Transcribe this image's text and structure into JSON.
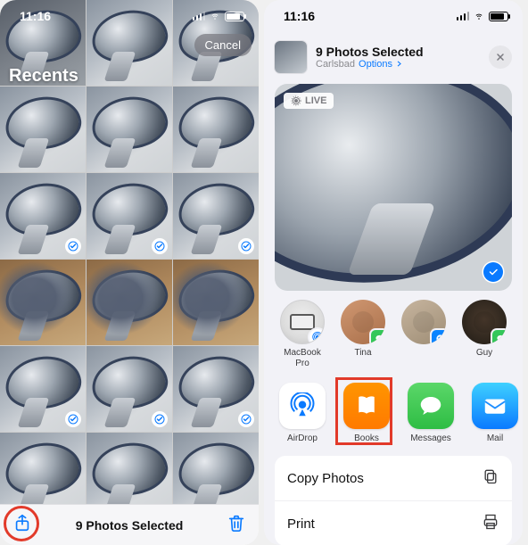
{
  "status": {
    "time": "11:16"
  },
  "left": {
    "album_title": "Recents",
    "cancel_label": "Cancel",
    "selected_summary": "9 Photos Selected",
    "thumbs": [
      {
        "sel": false,
        "v": "dark"
      },
      {
        "sel": false,
        "v": ""
      },
      {
        "sel": false,
        "v": ""
      },
      {
        "sel": false,
        "v": ""
      },
      {
        "sel": false,
        "v": ""
      },
      {
        "sel": false,
        "v": ""
      },
      {
        "sel": true,
        "v": ""
      },
      {
        "sel": true,
        "v": ""
      },
      {
        "sel": true,
        "v": ""
      },
      {
        "sel": false,
        "v": "wood"
      },
      {
        "sel": false,
        "v": "wood"
      },
      {
        "sel": false,
        "v": "wood"
      },
      {
        "sel": true,
        "v": ""
      },
      {
        "sel": true,
        "v": ""
      },
      {
        "sel": true,
        "v": ""
      },
      {
        "sel": false,
        "v": ""
      },
      {
        "sel": false,
        "v": ""
      },
      {
        "sel": false,
        "v": ""
      }
    ]
  },
  "right": {
    "header_title": "9 Photos Selected",
    "header_location": "Carlsbad",
    "header_options": "Options",
    "live_badge": "LIVE",
    "contacts": [
      {
        "name": "MacBook Pro",
        "kind": "mac",
        "badge": "airdrop"
      },
      {
        "name": "Tina",
        "kind": "p1",
        "badge": "msg"
      },
      {
        "name": "",
        "kind": "p2",
        "badge": "skype"
      },
      {
        "name": "Guy",
        "kind": "p3",
        "badge": "msg"
      },
      {
        "name": "",
        "kind": "p4",
        "badge": ""
      }
    ],
    "apps": [
      {
        "name": "AirDrop",
        "icon": "airdrop"
      },
      {
        "name": "Books",
        "icon": "books"
      },
      {
        "name": "Messages",
        "icon": "messages"
      },
      {
        "name": "Mail",
        "icon": "mail"
      },
      {
        "name": "",
        "icon": "more"
      }
    ],
    "actions": [
      {
        "label": "Copy Photos",
        "icon": "copy"
      },
      {
        "label": "Print",
        "icon": "print"
      }
    ]
  },
  "colors": {
    "accent": "#0a7aff",
    "highlight": "#e23a2a"
  }
}
